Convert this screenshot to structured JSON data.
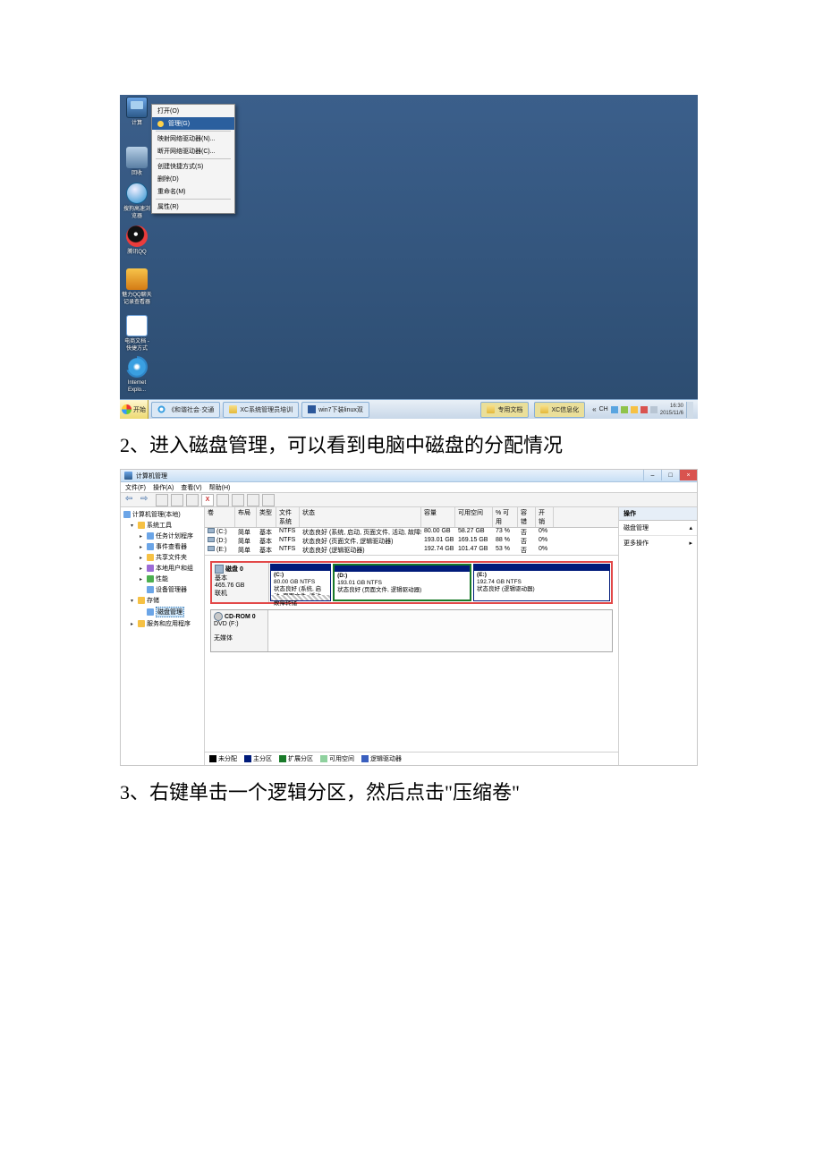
{
  "captions": {
    "step2": "2、进入磁盘管理，可以看到电脑中磁盘的分配情况",
    "step3": "3、右键单击一个逻辑分区，然后点击\"压缩卷\""
  },
  "desktop": {
    "icons": {
      "computer": "计算",
      "recycle": "回收",
      "browser": "搜狗高速浏览器",
      "qq": "腾讯QQ",
      "tool": "魅力QQ聊天记录查看器",
      "doc": "电商文档 - 快捷方式",
      "ie": "Internet Explo..."
    },
    "context_menu": {
      "open": "打开(O)",
      "manage": "管理(G)",
      "map": "映射网络驱动器(N)...",
      "disconnect": "断开网络驱动器(C)...",
      "shortcut": "创建快捷方式(S)",
      "delete": "删除(D)",
      "rename": "重命名(M)",
      "properties": "属性(R)"
    },
    "taskbar": {
      "start": "开始",
      "item1": "《和谐社会·交通",
      "item2": "XC系统管理员培训",
      "item3": "win7下装linux双",
      "folder1": "专用文档",
      "folder2": "XC信息化",
      "ime": "CH",
      "clock_time": "16:30",
      "clock_date": "2015/11/6"
    }
  },
  "diskmgmt": {
    "title": "计算机管理",
    "menu": {
      "file": "文件(F)",
      "action": "操作(A)",
      "view": "查看(V)",
      "help": "帮助(H)"
    },
    "tree": {
      "root": "计算机管理(本地)",
      "systools": "系统工具",
      "scheduler": "任务计划程序",
      "eventviewer": "事件查看器",
      "shared": "共享文件夹",
      "users": "本地用户和组",
      "perf": "性能",
      "devmgr": "设备管理器",
      "storage": "存储",
      "diskmgmt": "磁盘管理",
      "services": "服务和应用程序"
    },
    "columns": {
      "volume": "卷",
      "layout": "布局",
      "type": "类型",
      "fs": "文件系统",
      "status": "状态",
      "capacity": "容量",
      "free": "可用空间",
      "pct": "% 可用",
      "fault": "容错",
      "overhead": "开销"
    },
    "volumes": [
      {
        "name": "(C:)",
        "layout": "简单",
        "type": "基本",
        "fs": "NTFS",
        "status": "状态良好 (系统, 启动, 页面文件, 活动, 故障转储, 主分区)",
        "capacity": "80.00 GB",
        "free": "58.27 GB",
        "pct": "73 %",
        "fault": "否",
        "overhead": "0%"
      },
      {
        "name": "(D:)",
        "layout": "简单",
        "type": "基本",
        "fs": "NTFS",
        "status": "状态良好 (页面文件, 逻辑驱动器)",
        "capacity": "193.01 GB",
        "free": "169.15 GB",
        "pct": "88 %",
        "fault": "否",
        "overhead": "0%"
      },
      {
        "name": "(E:)",
        "layout": "简单",
        "type": "基本",
        "fs": "NTFS",
        "status": "状态良好 (逻辑驱动器)",
        "capacity": "192.74 GB",
        "free": "101.47 GB",
        "pct": "53 %",
        "fault": "否",
        "overhead": "0%"
      }
    ],
    "disk0": {
      "title": "磁盘 0",
      "type": "基本",
      "size": "465.76 GB",
      "status": "联机",
      "parts": {
        "c": {
          "label": "(C:)",
          "line2": "80.00 GB NTFS",
          "line3": "状态良好 (系统, 启动, 页面文件, 活动, 故障转储"
        },
        "d": {
          "label": "(D:)",
          "line2": "193.01 GB NTFS",
          "line3": "状态良好 (页面文件, 逻辑驱动器)"
        },
        "e": {
          "label": "(E:)",
          "line2": "192.74 GB NTFS",
          "line3": "状态良好 (逻辑驱动器)"
        }
      }
    },
    "cdrom": {
      "title": "CD-ROM 0",
      "type": "DVD (F:)",
      "status": "无媒体"
    },
    "legend": {
      "unalloc": "未分配",
      "primary": "主分区",
      "extended": "扩展分区",
      "free": "可用空间",
      "logical": "逻辑驱动器"
    },
    "actions": {
      "header": "操作",
      "item1": "磁盘管理",
      "item2": "更多操作"
    }
  }
}
